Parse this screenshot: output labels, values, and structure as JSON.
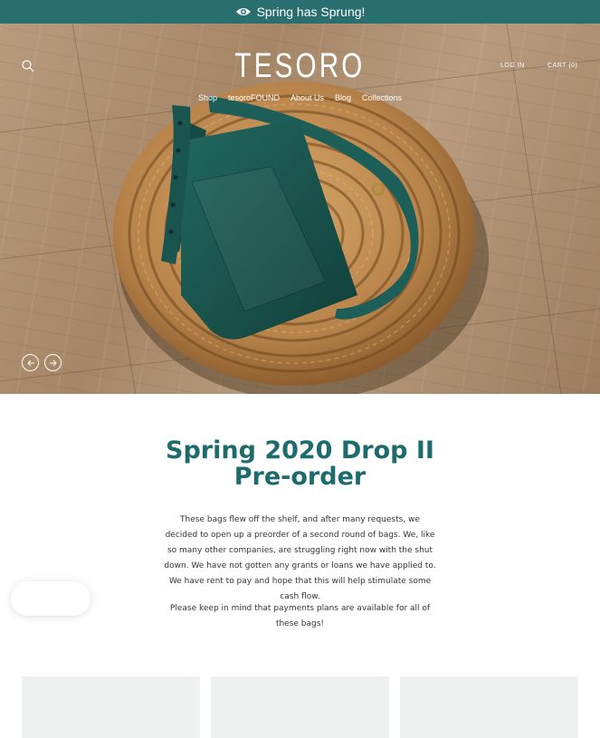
{
  "announcement": {
    "text": "Spring has Sprung!",
    "icon": "eye-icon"
  },
  "header": {
    "logo": "TESORO",
    "search_icon": "search-icon",
    "login": "LOG IN",
    "cart": "CART (0)"
  },
  "nav": {
    "items": [
      {
        "label": "Shop"
      },
      {
        "label": "tesoroFOUND"
      },
      {
        "label": "About Us"
      },
      {
        "label": "Blog"
      },
      {
        "label": "Collections"
      }
    ]
  },
  "slideshow": {
    "prev_icon": "arrow-left-icon",
    "next_icon": "arrow-right-icon"
  },
  "main": {
    "title": "Spring 2020 Drop II Pre-order",
    "paragraphs": [
      "These bags flew off the shelf, and after many requests, we decided to open up a preorder of a second round of bags. We, like so many other companies, are struggling right now with the shut down. We have not gotten any grants or loans we have applied to. We have rent to pay and hope that this will help stimulate some cash flow.",
      "Please keep in mind that payments plans are available for all of these bags!"
    ]
  },
  "colors": {
    "announcement_bg": "#2a6f70",
    "title": "#1d6b6c",
    "bag": "#1b5a53"
  }
}
